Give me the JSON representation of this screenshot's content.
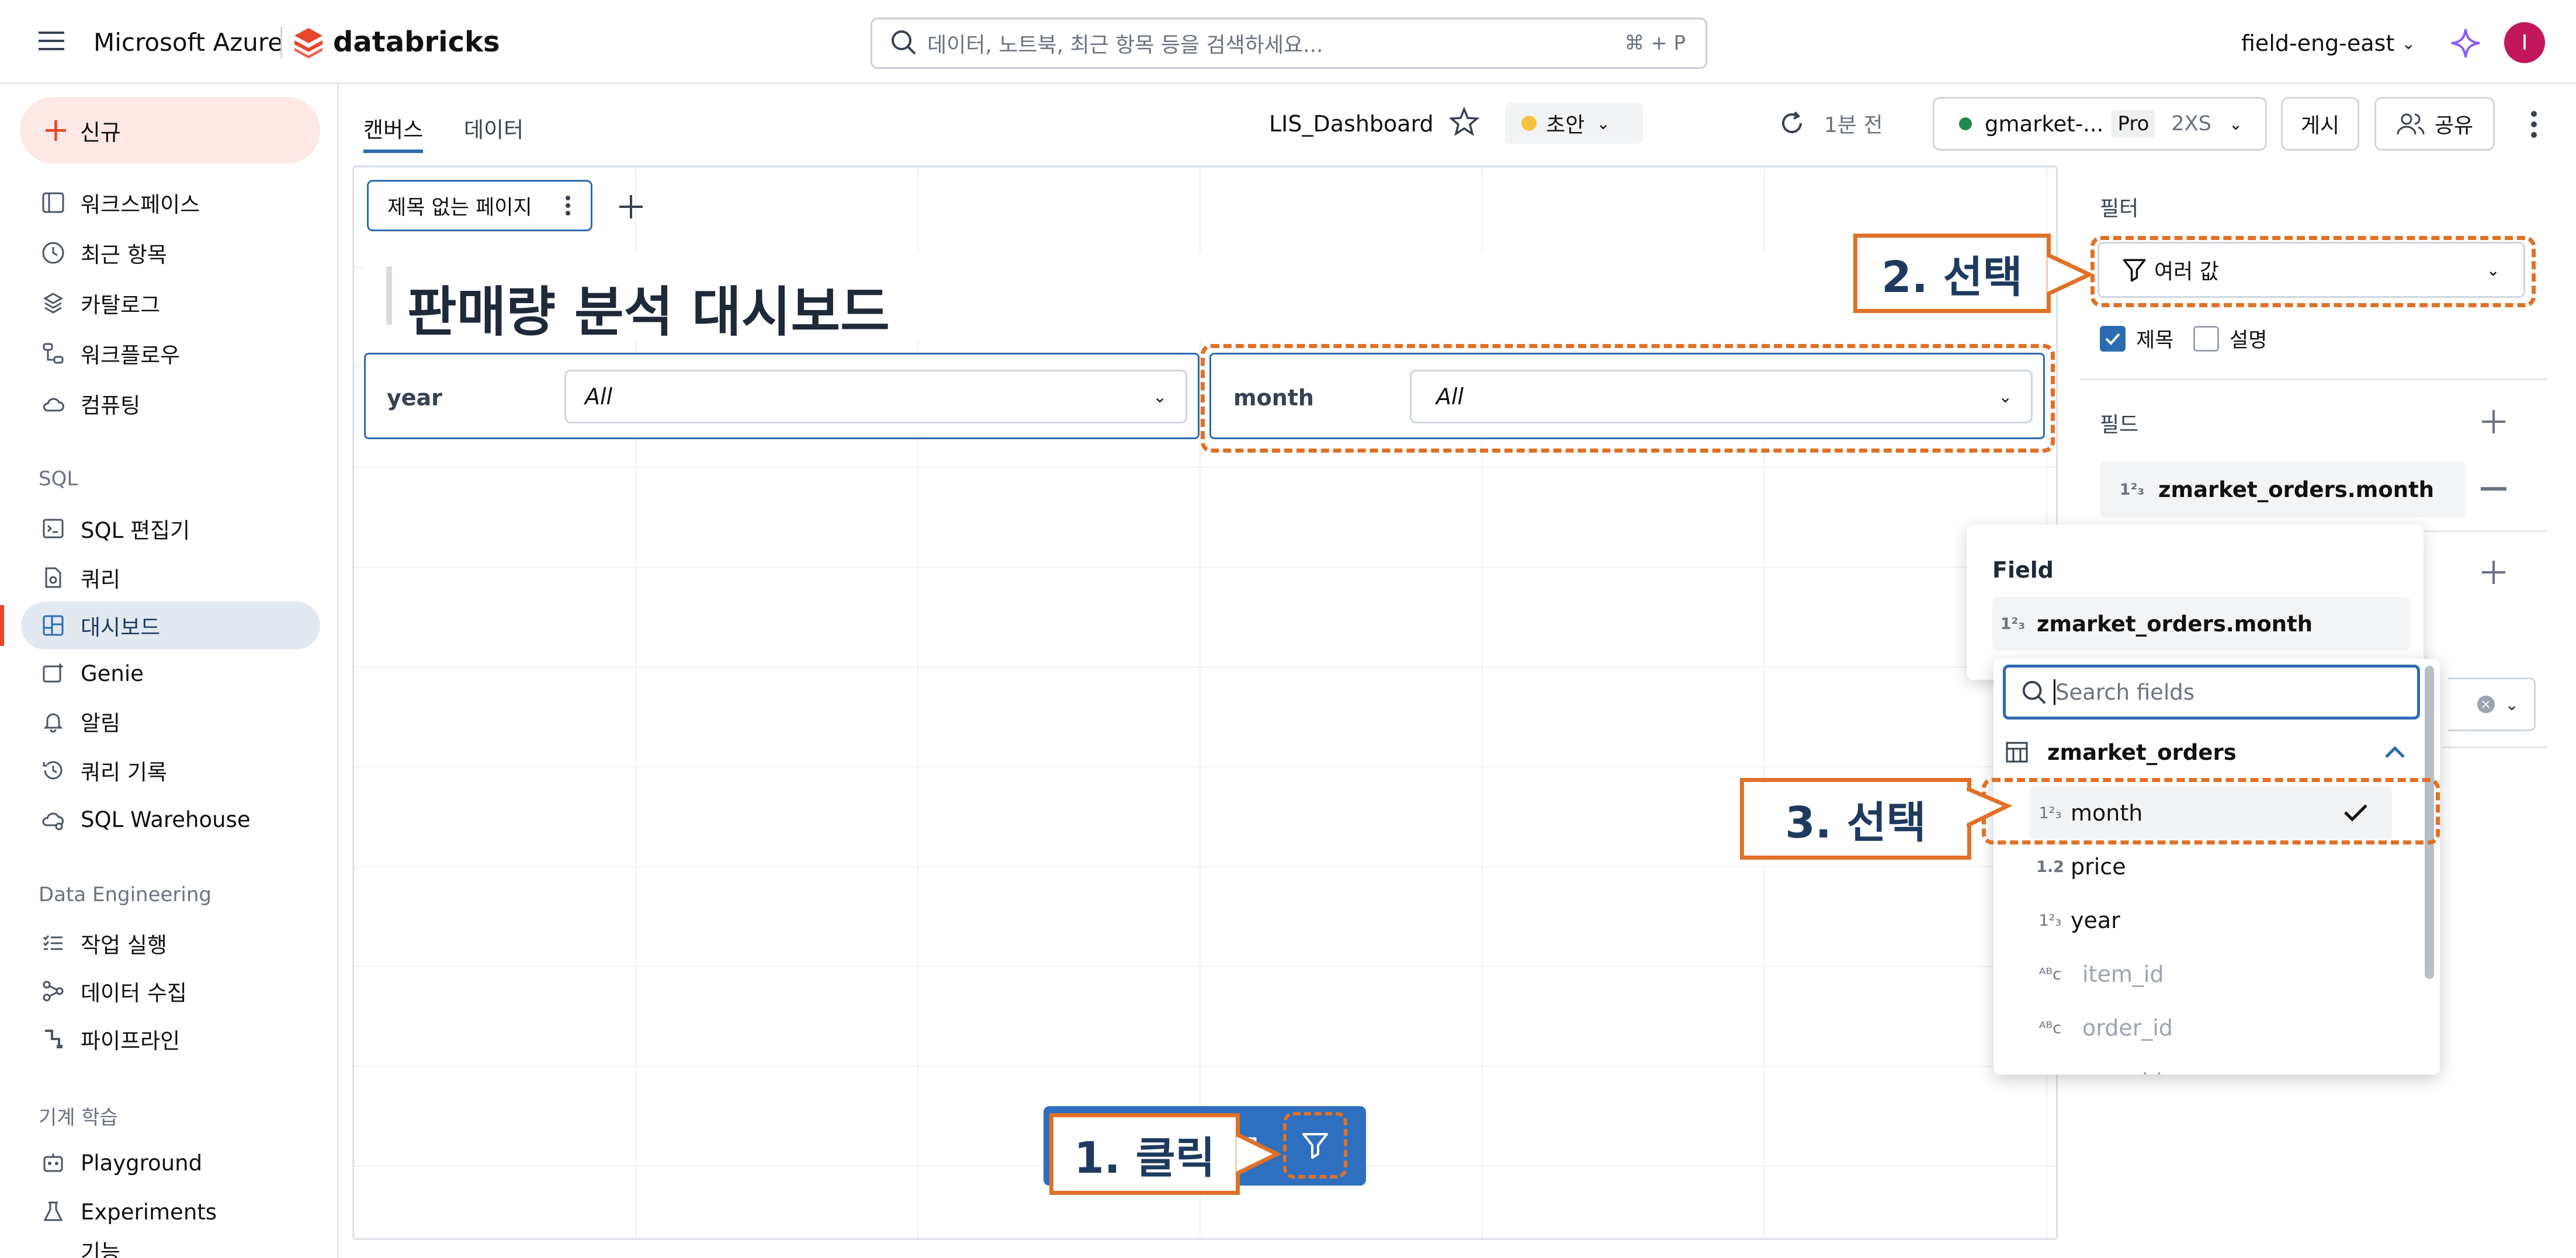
{
  "topbar": {
    "cloud": "Microsoft Azure",
    "brand": "databricks",
    "search_placeholder": "데이터, 노트북, 최근 항목 등을 검색하세요...",
    "search_shortcut": "⌘ + P",
    "workspace": "field-eng-east",
    "avatar_initial": "I"
  },
  "sidebar": {
    "new_label": "신규",
    "items": [
      {
        "label": "워크스페이스",
        "icon": "folder-icon"
      },
      {
        "label": "최근 항목",
        "icon": "clock-icon"
      },
      {
        "label": "카탈로그",
        "icon": "catalog-icon"
      },
      {
        "label": "워크플로우",
        "icon": "workflow-icon"
      },
      {
        "label": "컴퓨팅",
        "icon": "cloud-icon"
      }
    ],
    "sql_section": "SQL",
    "sql_items": [
      {
        "label": "SQL 편집기",
        "icon": "editor-icon"
      },
      {
        "label": "쿼리",
        "icon": "query-icon"
      },
      {
        "label": "대시보드",
        "icon": "dashboard-icon",
        "active": true
      },
      {
        "label": "Genie",
        "icon": "genie-icon"
      },
      {
        "label": "알림",
        "icon": "bell-icon"
      },
      {
        "label": "쿼리 기록",
        "icon": "history-icon"
      },
      {
        "label": "SQL Warehouse",
        "icon": "warehouse-icon"
      }
    ],
    "de_section": "Data Engineering",
    "de_items": [
      {
        "label": "작업 실행",
        "icon": "list-icon"
      },
      {
        "label": "데이터 수집",
        "icon": "ingest-icon"
      },
      {
        "label": "파이프라인",
        "icon": "pipeline-icon"
      }
    ],
    "ml_section": "기계 학습",
    "ml_items": [
      {
        "label": "Playground",
        "icon": "robot-icon"
      },
      {
        "label": "Experiments",
        "icon": "flask-icon"
      },
      {
        "label": "기능",
        "icon": "feature-icon"
      }
    ]
  },
  "header": {
    "tabs": [
      "캔버스",
      "데이터"
    ],
    "active_tab": "캔버스",
    "dashboard_name": "LIS_Dashboard",
    "status": "초안",
    "refreshed": "1분 전",
    "warehouse_name": "gmarket-...",
    "warehouse_tier": "Pro",
    "warehouse_size": "2XS",
    "publish": "게시",
    "share": "공유"
  },
  "canvas": {
    "page_tab": "제목 없는 페이지",
    "title": "판매량 분석 대시보드",
    "filters": [
      {
        "label": "year",
        "value": "All"
      },
      {
        "label": "month",
        "value": "All"
      }
    ],
    "toolbar_hidden_glyph": "⊡"
  },
  "panel": {
    "filter_heading": "필터",
    "filter_type": "여러 값",
    "opt_title": "제목",
    "opt_title_checked": true,
    "opt_desc": "설명",
    "opt_desc_checked": false,
    "fields_heading": "필드",
    "selected_field": "zmarket_orders.month"
  },
  "popup": {
    "heading": "Field",
    "current": "zmarket_orders.month",
    "search_placeholder": "Search fields",
    "table": "zmarket_orders",
    "fields": [
      {
        "type": "1²₃",
        "name": "month",
        "selected": true,
        "disabled": false
      },
      {
        "type": "1.2",
        "name": "price",
        "selected": false,
        "disabled": false
      },
      {
        "type": "1²₃",
        "name": "year",
        "selected": false,
        "disabled": false
      },
      {
        "type": "ᴬᴮc",
        "name": "item_id",
        "selected": false,
        "disabled": true
      },
      {
        "type": "ᴬᴮc",
        "name": "order_id",
        "selected": false,
        "disabled": true
      },
      {
        "type": "ᴬᴮc",
        "name": "user_id",
        "selected": false,
        "disabled": true
      }
    ]
  },
  "annotations": {
    "step1": "1. 클릭",
    "step2": "2. 선택",
    "step3": "3. 선택"
  },
  "colors": {
    "accent": "#2b6cb0",
    "annotation": "#e07126",
    "brand": "#e8472b",
    "toolbar_blue": "#2f6fbf"
  }
}
